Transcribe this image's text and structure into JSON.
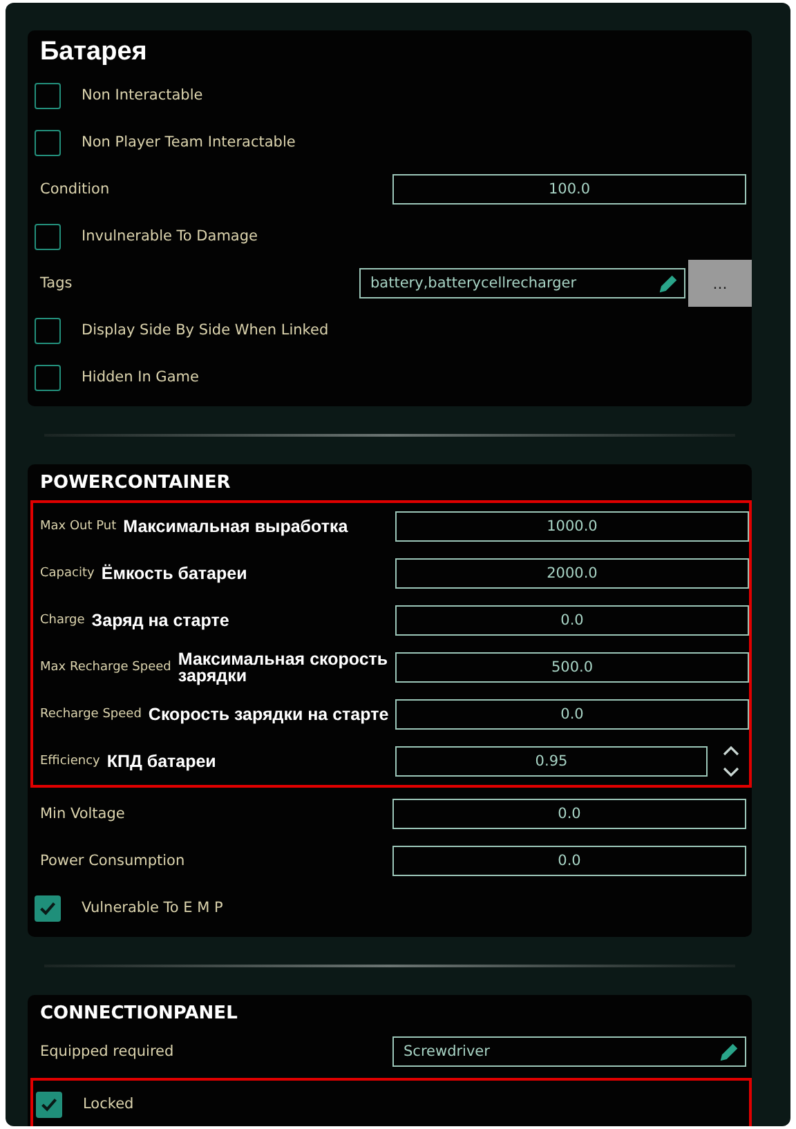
{
  "sections": [
    {
      "title": "Батарея",
      "kind": "main",
      "rows": [
        {
          "kind": "checkbox",
          "label": "Non Interactable",
          "checked": false
        },
        {
          "kind": "checkbox",
          "label": "Non Player Team Interactable",
          "checked": false
        },
        {
          "kind": "number",
          "label": "Condition",
          "value": "100.0"
        },
        {
          "kind": "checkbox",
          "label": "Invulnerable To Damage",
          "checked": false
        },
        {
          "kind": "text",
          "label": "Tags",
          "value": "battery,batterycellrecharger",
          "button": "..."
        },
        {
          "kind": "checkbox",
          "label": "Display Side By Side When Linked",
          "checked": false
        },
        {
          "kind": "checkbox",
          "label": "Hidden In Game",
          "checked": false
        }
      ]
    },
    {
      "title": "POWERCONTAINER",
      "kind": "component",
      "rows": [
        {
          "kind": "group",
          "rows": [
            {
              "kind": "number",
              "label": "Max Out Put",
              "note": "Максимальная выработка",
              "value": "1000.0"
            },
            {
              "kind": "number",
              "label": "Capacity",
              "note": "Ёмкость батареи",
              "value": "2000.0"
            },
            {
              "kind": "number",
              "label": "Charge",
              "note": "Заряд на старте",
              "value": "0.0"
            },
            {
              "kind": "number",
              "label": "Max Recharge Speed",
              "note": "Максимальная скорость зарядки",
              "value": "500.0"
            },
            {
              "kind": "number",
              "label": "Recharge Speed",
              "note": "Скорость зарядки на старте",
              "value": "0.0"
            },
            {
              "kind": "number",
              "label": "Efficiency",
              "note": "КПД батареи",
              "value": "0.95",
              "spinner": true
            }
          ]
        },
        {
          "kind": "number",
          "label": "Min Voltage",
          "value": "0.0"
        },
        {
          "kind": "number",
          "label": "Power Consumption",
          "value": "0.0"
        },
        {
          "kind": "checkbox",
          "label": "Vulnerable To E M P",
          "checked": true
        }
      ]
    },
    {
      "title": "CONNECTIONPANEL",
      "kind": "component",
      "rows": [
        {
          "kind": "text",
          "label": "Equipped required",
          "value": "Screwdriver"
        },
        {
          "kind": "group",
          "rows": [
            {
              "kind": "checkbox",
              "label": "Locked",
              "checked": true
            }
          ]
        }
      ]
    }
  ]
}
